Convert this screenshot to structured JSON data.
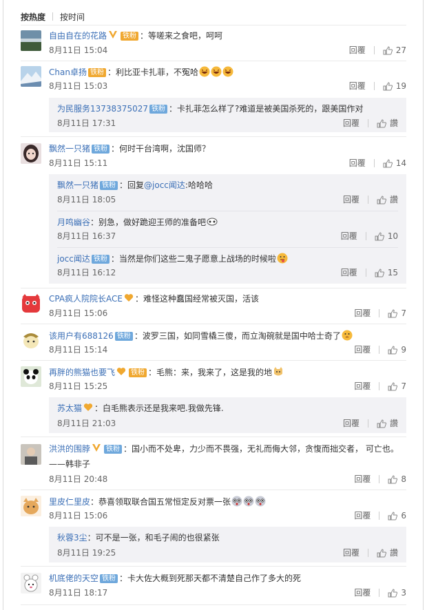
{
  "tabs": [
    "按热度",
    "按时间"
  ],
  "ui": {
    "reply": "回覆",
    "like_icon": "thumbs-up-icon",
    "fan_badge": "铁粉"
  },
  "comments": [
    {
      "name": "自由自在的花路",
      "text": "：等嗟来之食吧，呵呵",
      "time": "8月11日 15:04",
      "likes": "27"
    },
    {
      "name": "Chan卓扬",
      "text": "：利比亚卡扎菲，不冤哈",
      "time": "8月11日 15:03",
      "likes": "19",
      "replies": [
        {
          "name": "为民服务13738375027",
          "text": "：卡扎菲怎么样了?难道是被美国杀死的，跟美国作对",
          "time": "8月11日 17:31",
          "likes": "讚"
        }
      ]
    },
    {
      "name": "飘然一只猪",
      "text": "：何时干台湾啊，沈国师？",
      "time": "8月11日 15:11",
      "likes": "14",
      "replies": [
        {
          "name": "飘然一只猪",
          "text": "：回复",
          "mention": "@jocc闻达",
          "text2": ":哈哈哈",
          "time": "8月11日 18:05",
          "likes": "讚"
        },
        {
          "name": "月鸣幽谷",
          "text": "：别急，做好跪迎王师的准备吧",
          "time": "8月11日 16:37",
          "likes": "10"
        },
        {
          "name": "jocc闻达",
          "text": "：当然是你们这些二鬼子愿意上战场的时候啦",
          "time": "8月11日 16:12",
          "likes": "15"
        }
      ]
    },
    {
      "name": "CPA疯人院院长ACE",
      "text": "：难怪这种蠢国经常被灭国，活该",
      "time": "8月11日 15:06",
      "likes": "7"
    },
    {
      "name": "该用户有688126",
      "text": "：波罗三国，如同雪橇三傻，而立淘碗就是国中哈士奇了",
      "time": "8月11日 15:14",
      "likes": "9"
    },
    {
      "name": "再胖的熊猫也要飞",
      "text": "：毛熊：来，我来了，这是我的地",
      "time": "8月11日 15:25",
      "likes": "7",
      "replies": [
        {
          "name": "苏太猫",
          "text": "：白毛熊表示还是我来吧.我做先锋.",
          "time": "8月11日 21:03",
          "likes": "讚"
        }
      ]
    },
    {
      "name": "洪洪的围脖",
      "text": "：国小而不处卑，力少而不畏强，无礼而侮大邻，贪愎而拙交者， 可亡也。",
      "text_line2": "——韩非子",
      "time": "8月11日 20:48",
      "likes": "8"
    },
    {
      "name": "里皮仁里皮",
      "text": "：恭喜领取联合国五常恒定反对票一张",
      "time": "8月11日 15:06",
      "likes": "6",
      "replies": [
        {
          "name": "秋蓉3尘",
          "text": "：可不是一张，和毛子闹的也很紧张",
          "time": "8月11日 19:25",
          "likes": "讚"
        }
      ]
    },
    {
      "name": "机底佬的天空",
      "text": "：卡大佐大概到死那天都不清楚自己作了多大的死",
      "time": "8月11日 18:17",
      "likes": "3"
    }
  ],
  "colors": {
    "link": "#3b6fb6",
    "badge": "#6fa8dc",
    "gold": "#f0a830",
    "sub_bg": "#f2f2f5"
  }
}
